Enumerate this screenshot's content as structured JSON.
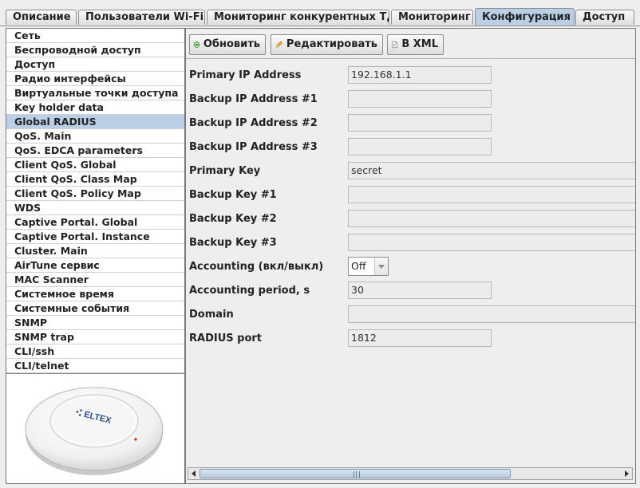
{
  "tabs": [
    {
      "label": "Описание"
    },
    {
      "label": "Пользователи Wi-Fi"
    },
    {
      "label": "Мониторинг конкурентных ТД"
    },
    {
      "label": "Мониторинг"
    },
    {
      "label": "Конфигурация",
      "active": true
    },
    {
      "label": "Доступ"
    }
  ],
  "nav": {
    "items": [
      {
        "label": "Сеть"
      },
      {
        "label": "Беспроводной доступ"
      },
      {
        "label": "Доступ"
      },
      {
        "label": "Радио интерфейсы"
      },
      {
        "label": "Виртуальные точки доступа"
      },
      {
        "label": "Key holder data"
      },
      {
        "label": "Global RADIUS",
        "selected": true
      },
      {
        "label": "QoS. Main"
      },
      {
        "label": "QoS. EDCA parameters"
      },
      {
        "label": "Client QoS. Global"
      },
      {
        "label": "Client QoS. Class Map"
      },
      {
        "label": "Client QoS. Policy Map"
      },
      {
        "label": "WDS"
      },
      {
        "label": "Captive Portal. Global"
      },
      {
        "label": "Captive Portal. Instance"
      },
      {
        "label": "Cluster. Main"
      },
      {
        "label": "AirTune сервис"
      },
      {
        "label": "MAC Scanner"
      },
      {
        "label": "Системное время"
      },
      {
        "label": "Системные события"
      },
      {
        "label": "SNMP"
      },
      {
        "label": "SNMP trap"
      },
      {
        "label": "CLI/ssh"
      },
      {
        "label": "CLI/telnet"
      }
    ],
    "device_logo_text": "ELTEX"
  },
  "toolbar": {
    "refresh_label": "Обновить",
    "edit_label": "Редактировать",
    "xml_label": "В XML"
  },
  "form": {
    "fields": [
      {
        "label": "Primary IP Address",
        "value": "192.168.1.1",
        "width": "short"
      },
      {
        "label": "Backup IP Address #1",
        "value": "",
        "width": "short"
      },
      {
        "label": "Backup IP Address #2",
        "value": "",
        "width": "short"
      },
      {
        "label": "Backup IP Address #3",
        "value": "",
        "width": "short"
      },
      {
        "label": "Primary Key",
        "value": "secret",
        "width": "long"
      },
      {
        "label": "Backup Key #1",
        "value": "",
        "width": "long"
      },
      {
        "label": "Backup Key #2",
        "value": "",
        "width": "long"
      },
      {
        "label": "Backup Key #3",
        "value": "",
        "width": "long"
      },
      {
        "label": "Accounting (вкл/выкл)",
        "value": "Off",
        "type": "select"
      },
      {
        "label": "Accounting period, s",
        "value": "30",
        "width": "short"
      },
      {
        "label": "Domain",
        "value": "",
        "width": "long"
      },
      {
        "label": "RADIUS port",
        "value": "1812",
        "width": "short"
      }
    ]
  },
  "colors": {
    "active_tab": "#b8cfe5",
    "selected_item": "#b8cfe5",
    "background": "#eeeeee"
  }
}
